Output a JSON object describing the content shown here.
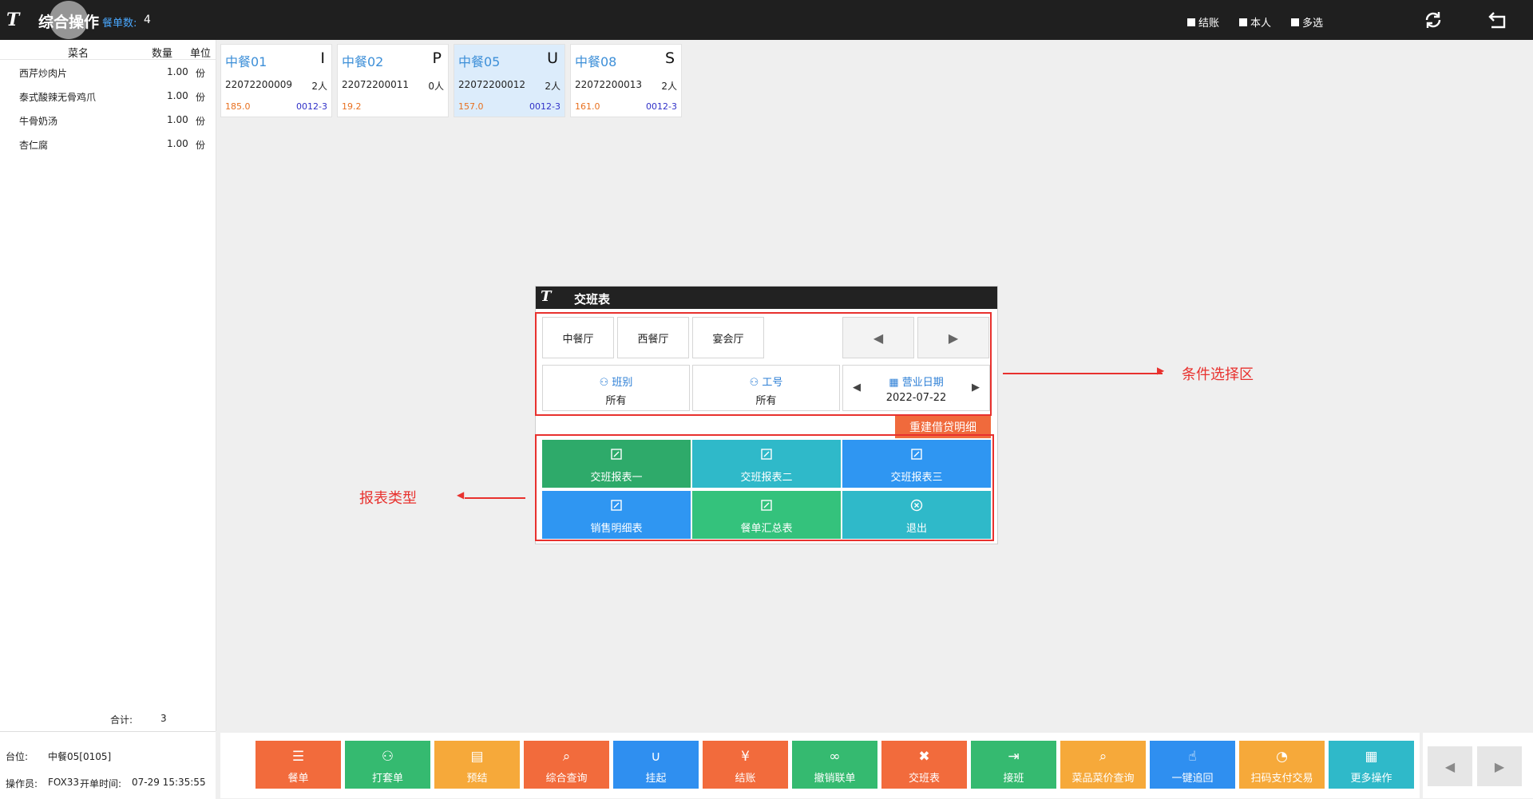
{
  "header": {
    "logo": "T",
    "title": "综合操作",
    "order_count_label": "餐单数:",
    "order_count": "4",
    "checks": [
      "结账",
      "本人",
      "多选"
    ]
  },
  "dish_list": {
    "columns": [
      "菜名",
      "数量",
      "单位"
    ],
    "rows": [
      {
        "name": "西芹炒肉片",
        "qty": "1.00",
        "unit": "份"
      },
      {
        "name": "泰式酸辣无骨鸡爪",
        "qty": "1.00",
        "unit": "份"
      },
      {
        "name": "牛骨奶汤",
        "qty": "1.00",
        "unit": "份"
      },
      {
        "name": "杏仁腐",
        "qty": "1.00",
        "unit": "份"
      }
    ],
    "total_label": "合计:",
    "total_value": "3"
  },
  "info": {
    "table_label": "台位:",
    "table_value": "中餐05[0105]",
    "operator_label": "操作员:",
    "operator_value": "FOX33",
    "open_time_label": "开单时间:",
    "open_time_value": "07-29 15:35:55"
  },
  "tables": [
    {
      "name": "中餐01",
      "letter": "I",
      "no": "22072200009",
      "people": "2人",
      "amount": "185.0",
      "code": "0012-3",
      "selected": false
    },
    {
      "name": "中餐02",
      "letter": "P",
      "no": "22072200011",
      "people": "0人",
      "amount": "19.2",
      "code": "",
      "selected": false
    },
    {
      "name": "中餐05",
      "letter": "U",
      "no": "22072200012",
      "people": "2人",
      "amount": "157.0",
      "code": "0012-3",
      "selected": true
    },
    {
      "name": "中餐08",
      "letter": "S",
      "no": "22072200013",
      "people": "2人",
      "amount": "161.0",
      "code": "0012-3",
      "selected": false
    }
  ],
  "dialog": {
    "logo": "T",
    "title": "交班表",
    "halls": [
      "中餐厅",
      "西餐厅",
      "宴会厅"
    ],
    "filters": {
      "shift": {
        "label": "班别",
        "value": "所有"
      },
      "staff": {
        "label": "工号",
        "value": "所有"
      },
      "date": {
        "label": "营业日期",
        "value": "2022-07-22"
      }
    },
    "rebuild": "重建借贷明细",
    "reports": [
      {
        "label": "交班报表一",
        "color": "#2eaa6a",
        "icon": "edit-icon"
      },
      {
        "label": "交班报表二",
        "color": "#2fb9c9",
        "icon": "edit-icon"
      },
      {
        "label": "交班报表三",
        "color": "#2f96f2",
        "icon": "edit-icon"
      },
      {
        "label": "销售明细表",
        "color": "#2f96f2",
        "icon": "edit-icon"
      },
      {
        "label": "餐单汇总表",
        "color": "#34c27c",
        "icon": "edit-icon"
      },
      {
        "label": "退出",
        "color": "#2fb9c9",
        "icon": "close-circle-icon"
      }
    ]
  },
  "annotations": {
    "condition": "条件选择区",
    "report_type": "报表类型"
  },
  "toolbar": [
    {
      "label": "餐单",
      "color": "#f26b3c",
      "icon": "list-icon"
    },
    {
      "label": "打套单",
      "color": "#35ba70",
      "icon": "user-check-icon"
    },
    {
      "label": "预结",
      "color": "#f6a93a",
      "icon": "document-icon"
    },
    {
      "label": "综合查询",
      "color": "#f26b3c",
      "icon": "search-icon"
    },
    {
      "label": "挂起",
      "color": "#2f8ff0",
      "icon": "magnet-icon"
    },
    {
      "label": "结账",
      "color": "#f26b3c",
      "icon": "yuan-icon"
    },
    {
      "label": "撤销联单",
      "color": "#35ba70",
      "icon": "link-icon"
    },
    {
      "label": "交班表",
      "color": "#f26b3c",
      "icon": "tools-icon"
    },
    {
      "label": "接班",
      "color": "#35ba70",
      "icon": "user-arrow-icon"
    },
    {
      "label": "菜品菜价查询",
      "color": "#f6a93a",
      "icon": "search-icon"
    },
    {
      "label": "一键追回",
      "color": "#2f8ff0",
      "icon": "hand-icon"
    },
    {
      "label": "扫码支付交易",
      "color": "#f6a93a",
      "icon": "pie-icon"
    },
    {
      "label": "更多操作",
      "color": "#2fb9c9",
      "icon": "grid-icon"
    }
  ]
}
